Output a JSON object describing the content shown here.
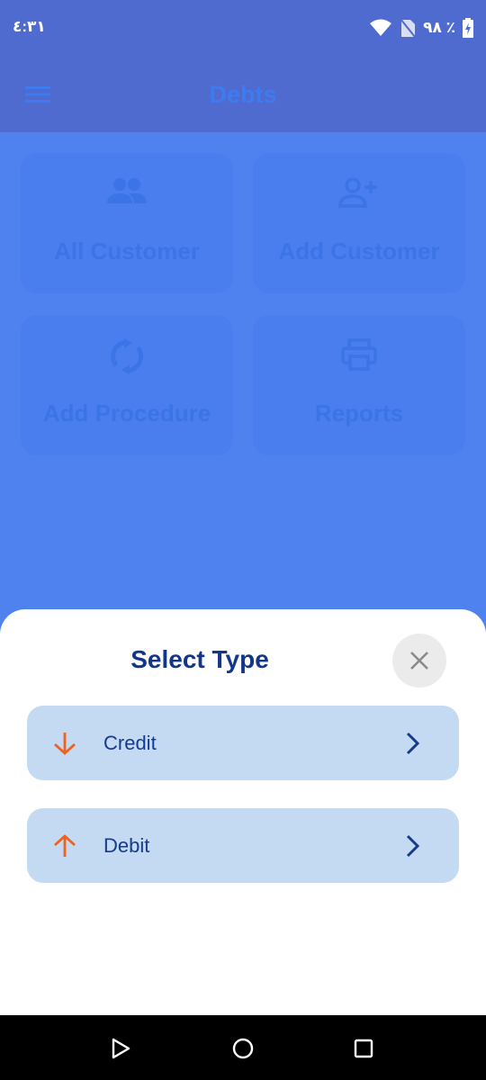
{
  "status_bar": {
    "time": "٤:٣١",
    "battery_text": "٩٨ ٪"
  },
  "app_bar": {
    "title": "Debts",
    "menu_icon": "menu-icon"
  },
  "tiles": [
    {
      "label": "All Customer",
      "icon": "people-icon"
    },
    {
      "label": "Add Customer",
      "icon": "person-add-icon"
    },
    {
      "label": "Add Procedure",
      "icon": "sync-icon"
    },
    {
      "label": "Reports",
      "icon": "printer-icon"
    }
  ],
  "sheet": {
    "title": "Select Type",
    "close_icon": "close-icon",
    "options": [
      {
        "label": "Credit",
        "icon": "arrow-down-icon"
      },
      {
        "label": "Debit",
        "icon": "arrow-up-icon"
      }
    ]
  },
  "colors": {
    "background": "#5082EF",
    "app_bar": "#4F6BD0",
    "sheet_title": "#12368A",
    "option_bg": "#C4DAF2",
    "accent_arrow": "#F0601E"
  }
}
